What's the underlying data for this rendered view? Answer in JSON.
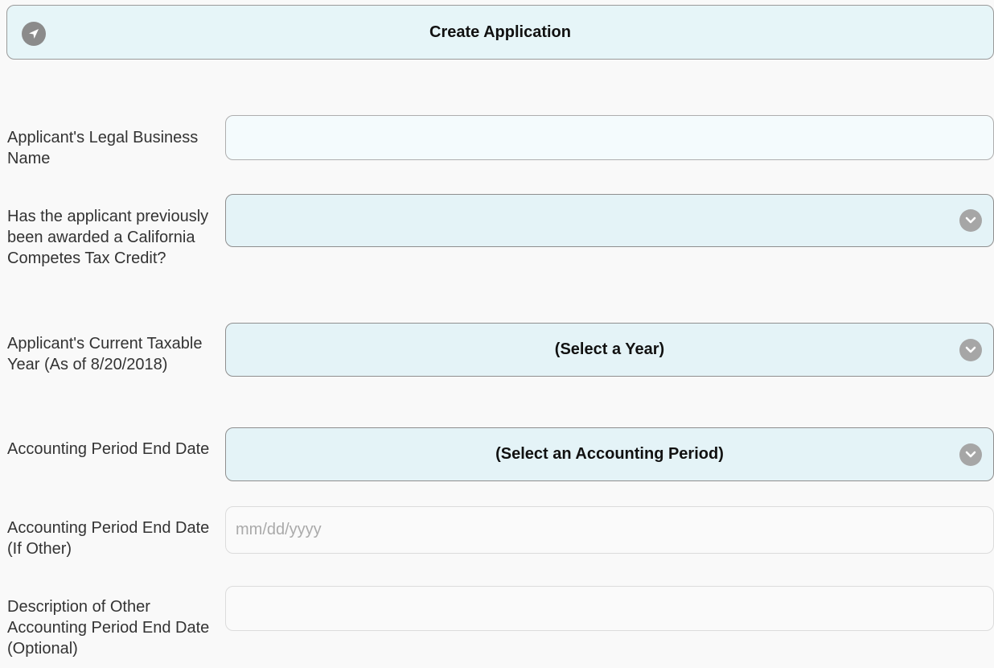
{
  "header": {
    "create_button_label": "Create Application",
    "icon": "navigation-arrow-icon"
  },
  "form": {
    "legal_name": {
      "label": "Applicant's Legal Business Name",
      "value": "",
      "placeholder": ""
    },
    "previous_award": {
      "label": "Has the applicant previously been awarded a California Competes Tax Credit?",
      "selected": ""
    },
    "taxable_year": {
      "label": "Applicant's Current Taxable Year (As of 8/20/2018)",
      "selected": "(Select a Year)"
    },
    "accounting_period": {
      "label": "Accounting Period End Date",
      "selected": "(Select an Accounting Period)"
    },
    "period_end_other": {
      "label": "Accounting Period End Date (If Other)",
      "value": "",
      "placeholder": "mm/dd/yyyy"
    },
    "other_description": {
      "label": "Description of Other Accounting Period End Date (Optional)",
      "value": "",
      "placeholder": ""
    }
  },
  "icons": {
    "dropdown": "chevron-down-icon"
  },
  "colors": {
    "button_bg": "#e6f5f8",
    "select_bg": "#e4f3f7",
    "icon_gray": "#8b8b8b",
    "page_bg": "#f9f9f9"
  }
}
